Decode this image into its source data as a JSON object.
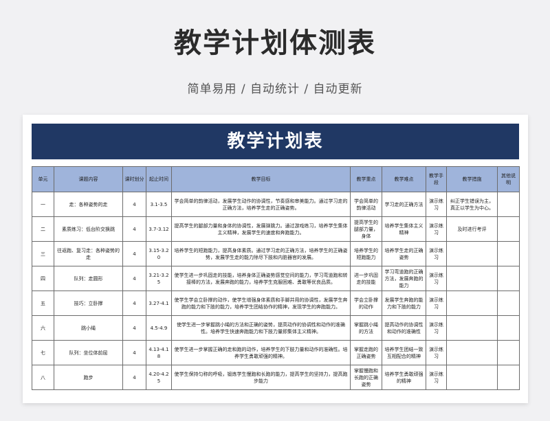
{
  "hero": {
    "title": "教学计划体测表",
    "subtitle": "简单易用  /  自动统计  /  自动更新"
  },
  "sheet": {
    "title": "教学计划表",
    "headers": [
      "单元",
      "课题内容",
      "课时划分",
      "起止时间",
      "教学目标",
      "教学重点",
      "教学难点",
      "教学手段",
      "教学措施",
      "其他说明"
    ],
    "rows": [
      [
        "一",
        "走：各种姿势的走",
        "4",
        "3.1-3.5",
        "学会简单的韵律活动，发展学生动作的协调性，节奏感和审美能力。通过学习走的正确方法，培养学生走的正确姿势。",
        "学会简单的韵律活动",
        "学习走的正确方法",
        "演示练习",
        "纠正学生错误为主，真正以学生为中心。",
        ""
      ],
      [
        "二",
        "素质练习：低台阶交换跳",
        "4",
        "3.7-3.12",
        "提高学生的腿部力量和身体的协调性，发展弹跳力。通过游戏练习，培养学生集体主义精神，发展学生的速度和奔跑能力。",
        "提高学生的腿部力量，身体",
        "培养学生集体主义精神",
        "演示练习",
        "及时进行考评",
        ""
      ],
      [
        "三",
        "往返跑、复习走：各种姿势的走",
        "4",
        "3.15-3.20",
        "培养学生的短跑能力，提高身体素质。通过学习走的正确方法，培养学生的正确姿势，发展学生走的能力除尽下肢和内脏器官的发展。",
        "培养学生的短跑能力",
        "培养学生走的正确姿势",
        "演示练习",
        "",
        ""
      ],
      [
        "四",
        "队列：走圆形",
        "4",
        "3.21-3.25",
        "使学生进一步巩固走的技能，培养身体正确姿势感觉空间的能力，学习弯道跑和转接棒的方法，发展奔跑的能力，培养学生克服困难、勇敢等优良品质。",
        "进一步巩固走的技能",
        "学习弯道跑的正确方法，发展奔跑的能力",
        "演示练习",
        "",
        ""
      ],
      [
        "五",
        "技巧：立卧撑",
        "4",
        "3.27-4.1",
        "使学生学会立卧撑的动作，使学生增强身体素质和手脚并用的协调性，发展学生奔跑的能力和下肢的能力，培养学生团结协作的精神，发现学生的奔跑能力。",
        "学会立卧撑的动作",
        "发展学生奔跑的能力和下肢的能力",
        "演示练习",
        "",
        ""
      ],
      [
        "六",
        "跳小绳",
        "4",
        "4.5-4.9",
        "使学生进一步掌握跳小绳的方法和正确的姿势，提高动作的协调性和动作的准确性。培养学生快速奔跑能力和下肢力量即集体主义精神。",
        "掌握跳小绳的方法",
        "提高动作的协调性和动作的准确性",
        "演示练习",
        "",
        ""
      ],
      [
        "七",
        "队列：坐位体前屈",
        "4",
        "4.13-4.18",
        "使学生进一步掌握正确的走和跑的动作，培养学生的下肢力量和动作的准确性。培养学生勇敢顽强的精神。",
        "掌握走跑的正确姿势",
        "培养学生团结一致互相配合的精神",
        "演示练习",
        "",
        ""
      ],
      [
        "八",
        "跑步",
        "4",
        "4.20-4.25",
        "使学生保持匀称的呼吸，锻炼学生慢跑和长跑的能力，提高学生的坚持力，提高跑步能力",
        "掌握慢跑和长跑的正确姿势",
        "培养学生勇敢顽强的精神",
        "演示练习",
        "",
        ""
      ]
    ]
  }
}
